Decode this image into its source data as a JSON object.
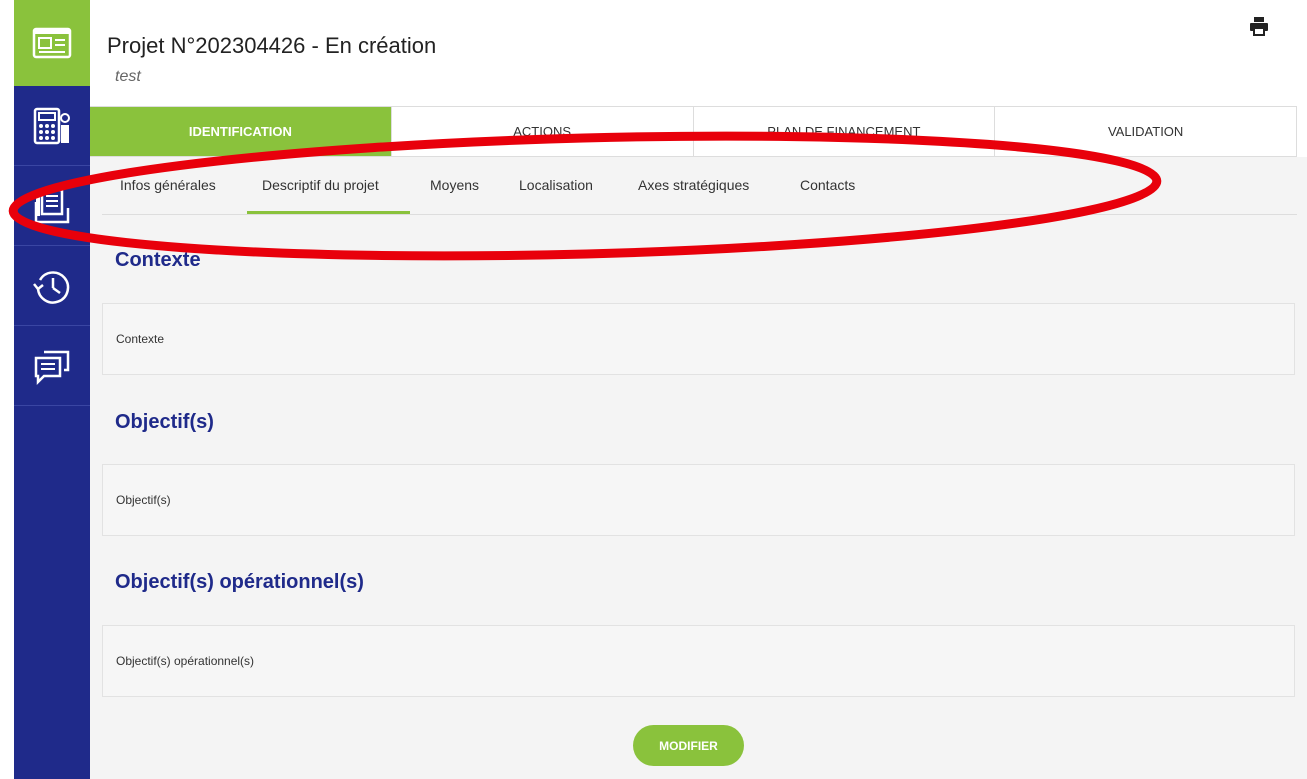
{
  "header": {
    "title": "Projet N°202304426 - En création",
    "subtitle": "test"
  },
  "sidebar": {
    "items": [
      {
        "icon": "id-card-icon",
        "active": true
      },
      {
        "icon": "calculator-icon",
        "active": false
      },
      {
        "icon": "folder-document-icon",
        "active": false
      },
      {
        "icon": "history-icon",
        "active": false
      },
      {
        "icon": "chat-icon",
        "active": false
      }
    ]
  },
  "main_tabs": [
    {
      "label": "IDENTIFICATION",
      "active": true
    },
    {
      "label": "ACTIONS",
      "active": false
    },
    {
      "label": "PLAN DE FINANCEMENT",
      "active": false
    },
    {
      "label": "VALIDATION",
      "active": false
    }
  ],
  "sub_tabs": [
    {
      "label": "Infos générales",
      "active": false
    },
    {
      "label": "Descriptif du projet",
      "active": true
    },
    {
      "label": "Moyens",
      "active": false
    },
    {
      "label": "Localisation",
      "active": false
    },
    {
      "label": "Axes stratégiques",
      "active": false
    },
    {
      "label": "Contacts",
      "active": false
    }
  ],
  "sections": [
    {
      "title": "Contexte",
      "value": "Contexte"
    },
    {
      "title": "Objectif(s)",
      "value": "Objectif(s)"
    },
    {
      "title": "Objectif(s) opérationnel(s)",
      "value": "Objectif(s) opérationnel(s)"
    }
  ],
  "actions": {
    "modify_label": "MODIFIER"
  },
  "colors": {
    "sidebar": "#1f2a8a",
    "accent_green": "#8ac23c",
    "heading_blue": "#1f2a8a",
    "annotation_red": "#e8000b"
  },
  "icons": {
    "print": "print-icon"
  }
}
